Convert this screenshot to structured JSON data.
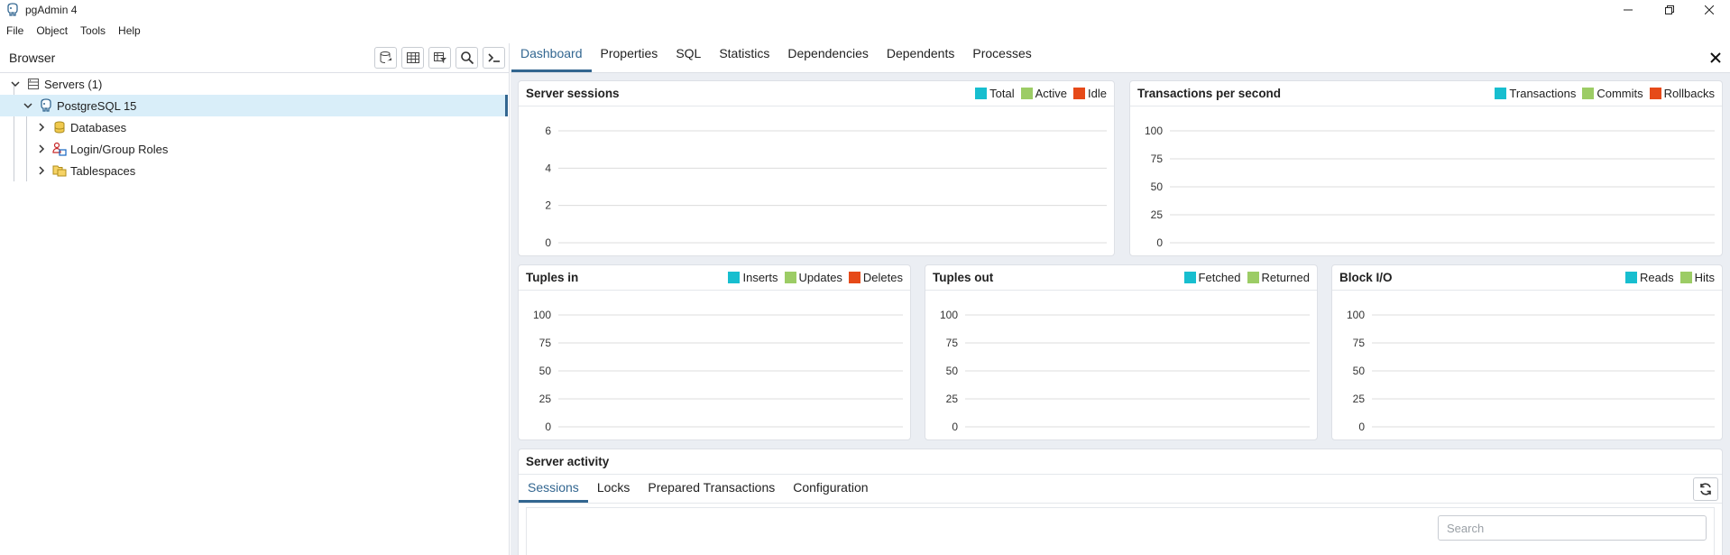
{
  "window": {
    "title": "pgAdmin 4"
  },
  "menu": [
    "File",
    "Object",
    "Tools",
    "Help"
  ],
  "browser": {
    "title": "Browser",
    "tree": [
      {
        "label": "Servers (1)",
        "expanded": true
      },
      {
        "label": "PostgreSQL 15",
        "expanded": true,
        "selected": true
      },
      {
        "label": "Databases",
        "expanded": false
      },
      {
        "label": "Login/Group Roles",
        "expanded": false
      },
      {
        "label": "Tablespaces",
        "expanded": false
      }
    ]
  },
  "tabs": [
    "Dashboard",
    "Properties",
    "SQL",
    "Statistics",
    "Dependencies",
    "Dependents",
    "Processes"
  ],
  "active_tab": "Dashboard",
  "colors": {
    "accent": "#326690",
    "total": "#17becf",
    "active": "#9ccc65",
    "idle": "#e64a19"
  },
  "charts": {
    "sessions": {
      "title": "Server sessions",
      "legend": [
        "Total",
        "Active",
        "Idle"
      ]
    },
    "tps": {
      "title": "Transactions per second",
      "legend": [
        "Transactions",
        "Commits",
        "Rollbacks"
      ]
    },
    "tuples_in": {
      "title": "Tuples in",
      "legend": [
        "Inserts",
        "Updates",
        "Deletes"
      ]
    },
    "tuples_out": {
      "title": "Tuples out",
      "legend": [
        "Fetched",
        "Returned"
      ]
    },
    "block_io": {
      "title": "Block I/O",
      "legend": [
        "Reads",
        "Hits"
      ]
    }
  },
  "chart_data": [
    {
      "type": "line",
      "title": "Server sessions",
      "yticks": [
        "6",
        "4",
        "2",
        "0"
      ],
      "series": [
        {
          "name": "Total",
          "values": []
        },
        {
          "name": "Active",
          "values": []
        },
        {
          "name": "Idle",
          "values": []
        }
      ]
    },
    {
      "type": "line",
      "title": "Transactions per second",
      "yticks": [
        "100",
        "75",
        "50",
        "25",
        "0"
      ],
      "series": [
        {
          "name": "Transactions",
          "values": []
        },
        {
          "name": "Commits",
          "values": []
        },
        {
          "name": "Rollbacks",
          "values": []
        }
      ]
    },
    {
      "type": "line",
      "title": "Tuples in",
      "yticks": [
        "100",
        "75",
        "50",
        "25",
        "0"
      ],
      "series": [
        {
          "name": "Inserts",
          "values": []
        },
        {
          "name": "Updates",
          "values": []
        },
        {
          "name": "Deletes",
          "values": []
        }
      ]
    },
    {
      "type": "line",
      "title": "Tuples out",
      "yticks": [
        "100",
        "75",
        "50",
        "25",
        "0"
      ],
      "series": [
        {
          "name": "Fetched",
          "values": []
        },
        {
          "name": "Returned",
          "values": []
        }
      ]
    },
    {
      "type": "line",
      "title": "Block I/O",
      "yticks": [
        "100",
        "75",
        "50",
        "25",
        "0"
      ],
      "series": [
        {
          "name": "Reads",
          "values": []
        },
        {
          "name": "Hits",
          "values": []
        }
      ]
    }
  ],
  "activity": {
    "title": "Server activity",
    "tabs": [
      "Sessions",
      "Locks",
      "Prepared Transactions",
      "Configuration"
    ],
    "search_placeholder": "Search"
  }
}
